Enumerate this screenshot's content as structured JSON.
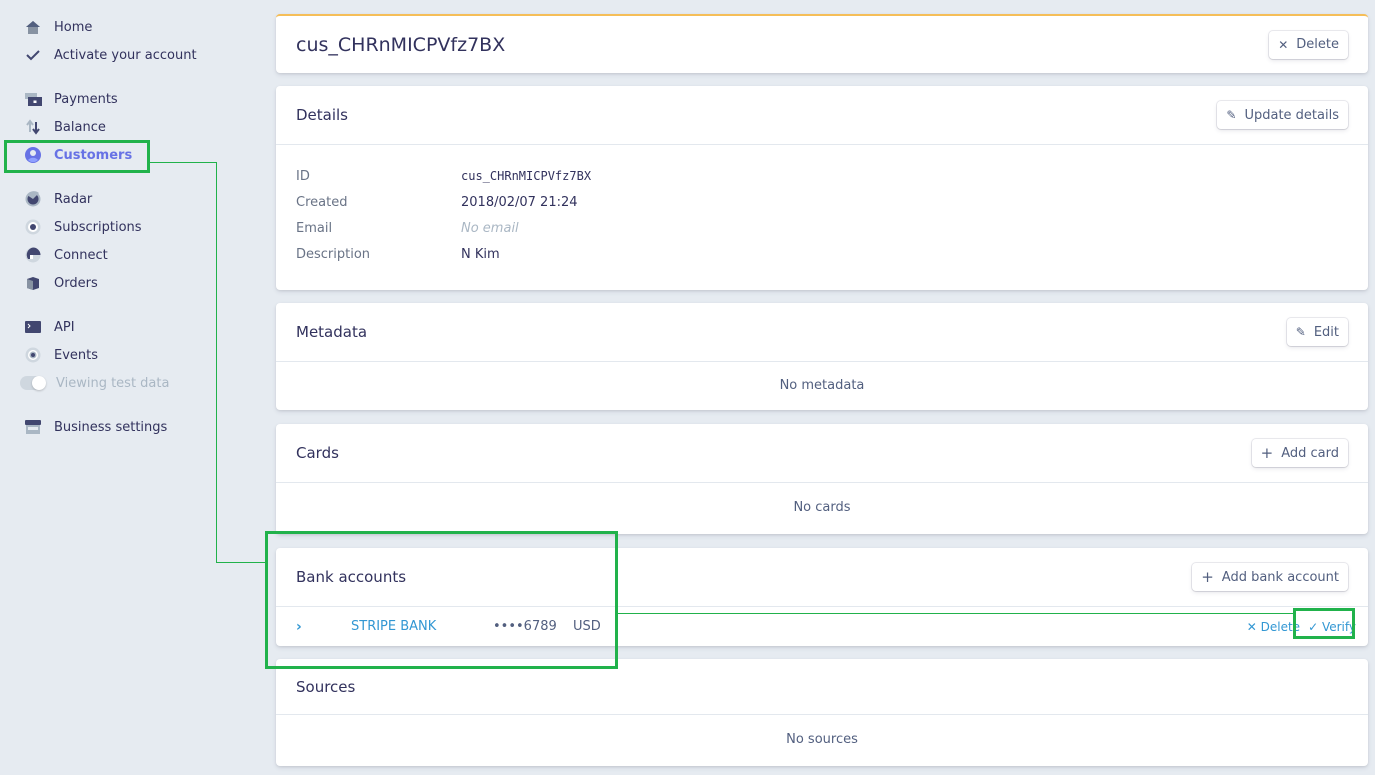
{
  "sidebar": {
    "items": [
      {
        "label": "Home",
        "icon": "home-icon"
      },
      {
        "label": "Activate your account",
        "icon": "check-icon"
      },
      {
        "label": "Payments",
        "icon": "payments-icon"
      },
      {
        "label": "Balance",
        "icon": "balance-icon"
      },
      {
        "label": "Customers",
        "icon": "customers-icon",
        "active": true
      },
      {
        "label": "Radar",
        "icon": "radar-icon"
      },
      {
        "label": "Subscriptions",
        "icon": "subscriptions-icon"
      },
      {
        "label": "Connect",
        "icon": "connect-icon"
      },
      {
        "label": "Orders",
        "icon": "orders-icon"
      },
      {
        "label": "API",
        "icon": "api-icon"
      },
      {
        "label": "Events",
        "icon": "events-icon"
      },
      {
        "label": "Viewing test data",
        "icon": "toggle-icon",
        "toggle": true
      },
      {
        "label": "Business settings",
        "icon": "business-icon"
      }
    ]
  },
  "header": {
    "title": "cus_CHRnMICPVfz7BX",
    "delete_label": "Delete"
  },
  "details": {
    "title": "Details",
    "update_label": "Update details",
    "rows": [
      {
        "label": "ID",
        "value": "cus_CHRnMICPVfz7BX"
      },
      {
        "label": "Created",
        "value": "2018/02/07 21:24"
      },
      {
        "label": "Email",
        "value": "No email"
      },
      {
        "label": "Description",
        "value": "N Kim"
      }
    ]
  },
  "metadata": {
    "title": "Metadata",
    "edit_label": "Edit",
    "empty": "No metadata"
  },
  "cards": {
    "title": "Cards",
    "add_label": "Add card",
    "empty": "No cards"
  },
  "bank_accounts": {
    "title": "Bank accounts",
    "add_label": "Add bank account",
    "rows": [
      {
        "bank": "STRIPE BANK",
        "last4": "••••6789",
        "currency": "USD",
        "delete_label": "Delete",
        "verify_label": "Verify"
      }
    ]
  },
  "sources": {
    "title": "Sources",
    "empty": "No sources"
  },
  "colors": {
    "accent": "#6772e5",
    "link": "#3297d3",
    "annotation": "#21b24b",
    "header_top_border": "#f5be58"
  }
}
